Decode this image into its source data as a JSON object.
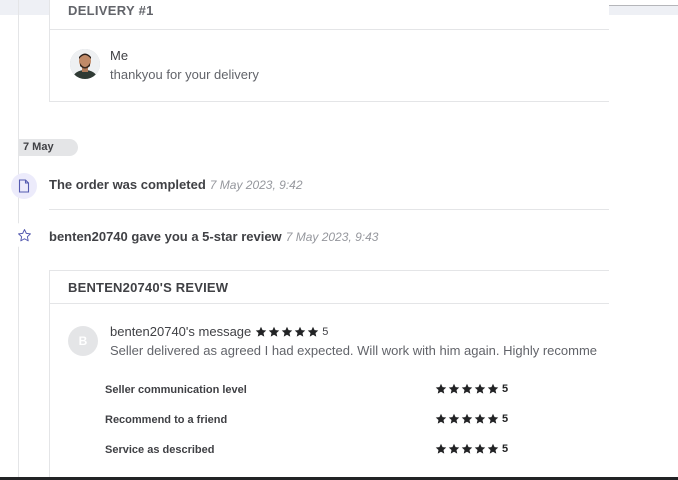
{
  "delivery": {
    "header": "DELIVERY #1",
    "sender_name": "Me",
    "message": "thankyou for your delivery"
  },
  "date_divider": "7 May",
  "events": [
    {
      "text": "The order was completed",
      "time": "7 May 2023, 9:42",
      "icon": "document-icon"
    },
    {
      "text": "benten20740 gave you a 5-star review",
      "time": "7 May 2023, 9:43",
      "icon": "star-outline-icon"
    }
  ],
  "review": {
    "header": "BENTEN20740'S REVIEW",
    "avatar_letter": "B",
    "title": "benten20740's message",
    "rating": "5",
    "stars": 5,
    "text": "Seller delivered as agreed I had expected. Will work with him again. Highly recommend",
    "criteria": [
      {
        "label": "Seller communication level",
        "rating": "5",
        "stars": 5
      },
      {
        "label": "Recommend to a friend",
        "rating": "5",
        "stars": 5
      },
      {
        "label": "Service as described",
        "rating": "5",
        "stars": 5
      }
    ]
  },
  "colors": {
    "accent_purple": "#ecebfb",
    "star": "#222325",
    "border": "#e4e5e7"
  }
}
